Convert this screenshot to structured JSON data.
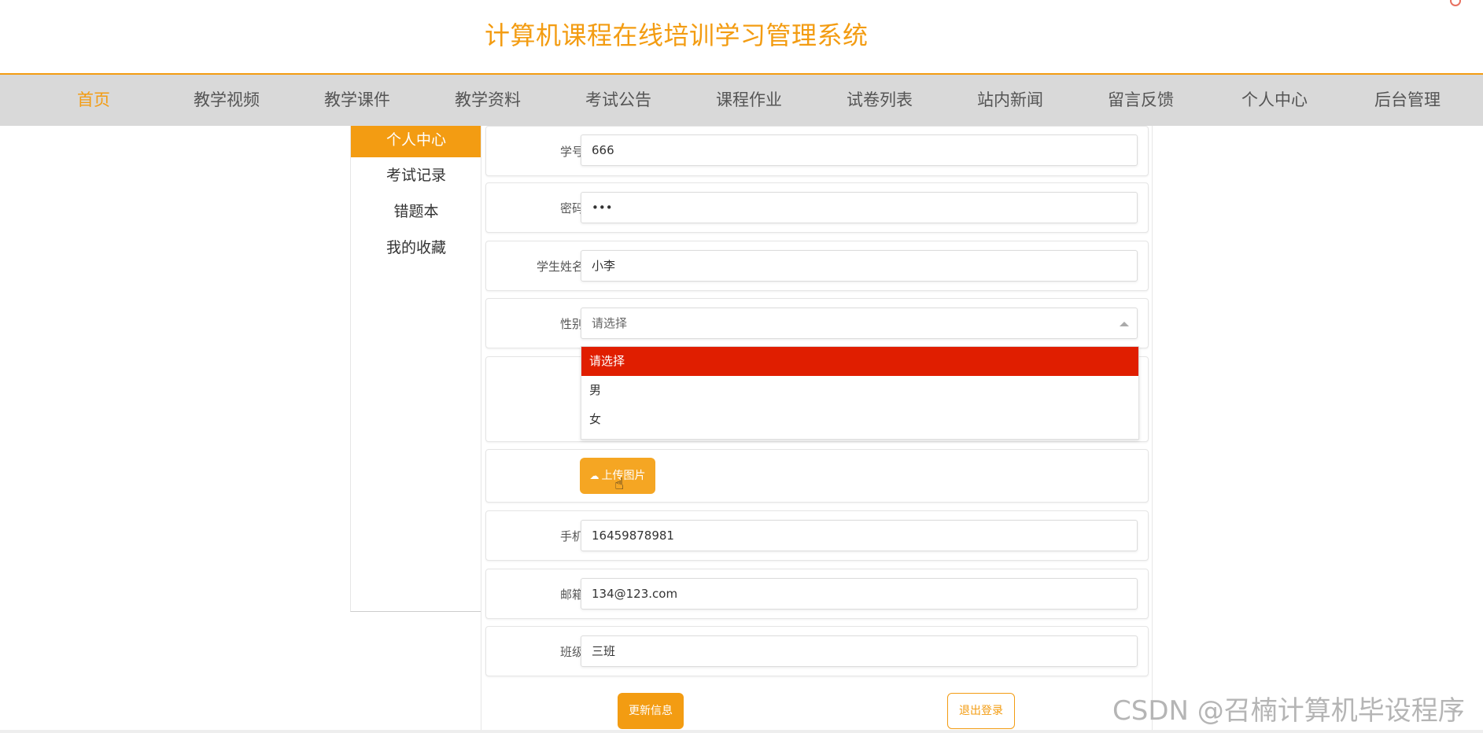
{
  "site": {
    "title": "计算机课程在线培训学习管理系统"
  },
  "nav": {
    "items": [
      {
        "label": "首页",
        "active": true
      },
      {
        "label": "教学视频"
      },
      {
        "label": "教学课件"
      },
      {
        "label": "教学资料"
      },
      {
        "label": "考试公告"
      },
      {
        "label": "课程作业"
      },
      {
        "label": "试卷列表"
      },
      {
        "label": "站内新闻"
      },
      {
        "label": "留言反馈"
      },
      {
        "label": "个人中心"
      },
      {
        "label": "后台管理"
      }
    ]
  },
  "sidebar": {
    "items": [
      {
        "label": "个人中心",
        "active": true
      },
      {
        "label": "考试记录"
      },
      {
        "label": "错题本"
      },
      {
        "label": "我的收藏"
      }
    ]
  },
  "form": {
    "student_id": {
      "label": "学号",
      "value": "666"
    },
    "password": {
      "label": "密码",
      "value": "•••"
    },
    "name": {
      "label": "学生姓名",
      "value": "小李"
    },
    "gender": {
      "label": "性别",
      "placeholder": "请选择",
      "options": [
        "请选择",
        "男",
        "女"
      ],
      "highlighted": "请选择"
    },
    "upload": {
      "label": "上传图片"
    },
    "phone": {
      "label": "手机",
      "value": "16459878981"
    },
    "email": {
      "label": "邮箱",
      "value": "134@123.com"
    },
    "class": {
      "label": "班级",
      "value": "三班"
    },
    "update_button": "更新信息",
    "logout_button": "退出登录"
  },
  "watermark": "CSDN @召楠计算机毕设程序",
  "colors": {
    "accent": "#f39c12",
    "highlight": "#e01e00",
    "nav_bg": "#d9d9d9"
  }
}
